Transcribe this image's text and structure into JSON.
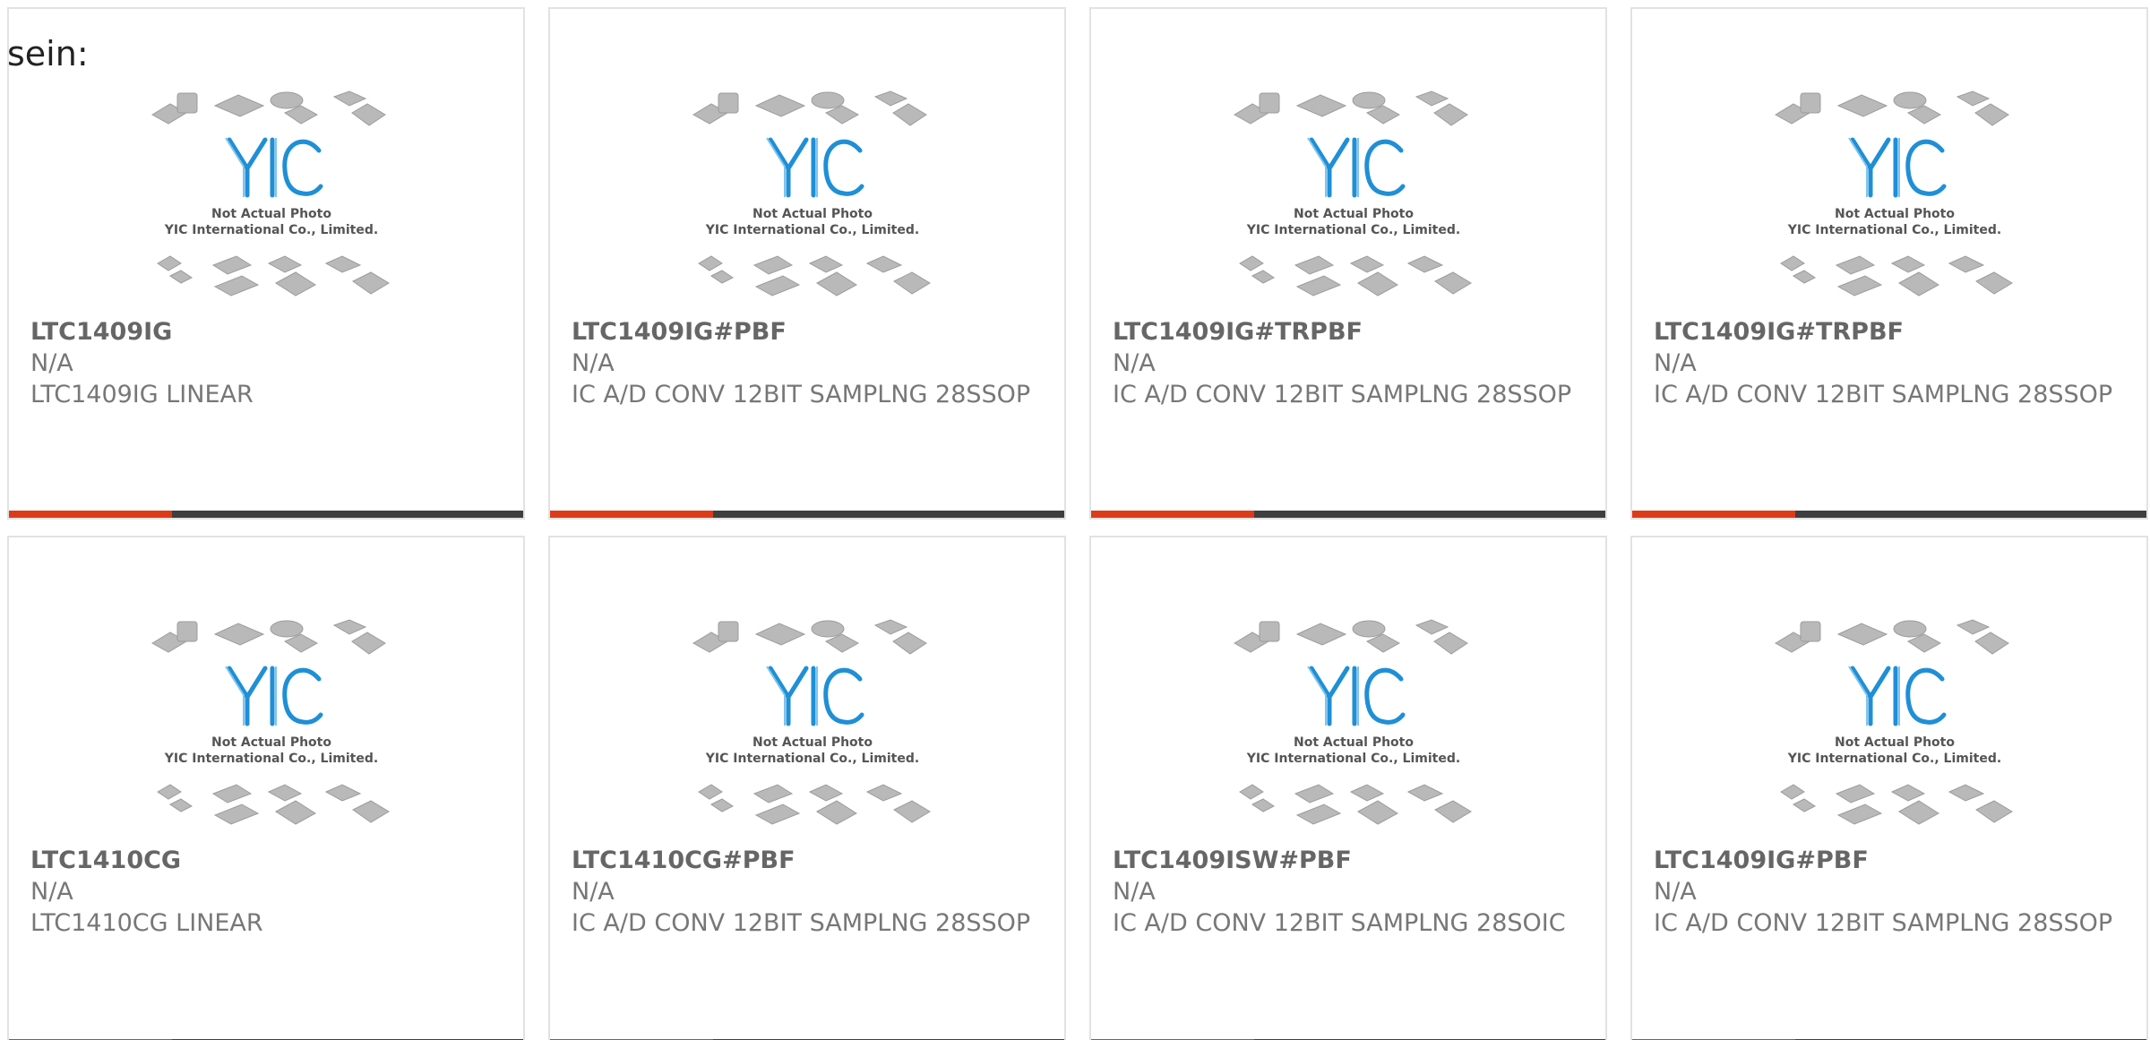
{
  "intro_text": "sein:",
  "placeholder": {
    "caption_line1": "Not Actual Photo",
    "caption_line2": "YIC International Co., Limited.",
    "logo_text": "YIC"
  },
  "colors": {
    "accent": "#dc3b1a",
    "bar": "#3f3f3f",
    "logo_blue": "#1f8fd6",
    "card_border": "#e2e2e2"
  },
  "products": [
    {
      "part": "LTC1409IG",
      "manufacturer": "N/A",
      "description": "LTC1409IG LINEAR"
    },
    {
      "part": "LTC1409IG#PBF",
      "manufacturer": "N/A",
      "description": "IC A/D CONV 12BIT SAMPLNG 28SSOP"
    },
    {
      "part": "LTC1409IG#TRPBF",
      "manufacturer": "N/A",
      "description": "IC A/D CONV 12BIT SAMPLNG 28SSOP"
    },
    {
      "part": "LTC1409IG#TRPBF",
      "manufacturer": "N/A",
      "description": "IC A/D CONV 12BIT SAMPLNG 28SSOP"
    },
    {
      "part": "LTC1410CG",
      "manufacturer": "N/A",
      "description": "LTC1410CG LINEAR"
    },
    {
      "part": "LTC1410CG#PBF",
      "manufacturer": "N/A",
      "description": "IC A/D CONV 12BIT SAMPLNG 28SSOP"
    },
    {
      "part": "LTC1409ISW#PBF",
      "manufacturer": "N/A",
      "description": "IC A/D CONV 12BIT SAMPLNG 28SOIC"
    },
    {
      "part": "LTC1409IG#PBF",
      "manufacturer": "N/A",
      "description": "IC A/D CONV 12BIT SAMPLNG 28SSOP"
    }
  ]
}
